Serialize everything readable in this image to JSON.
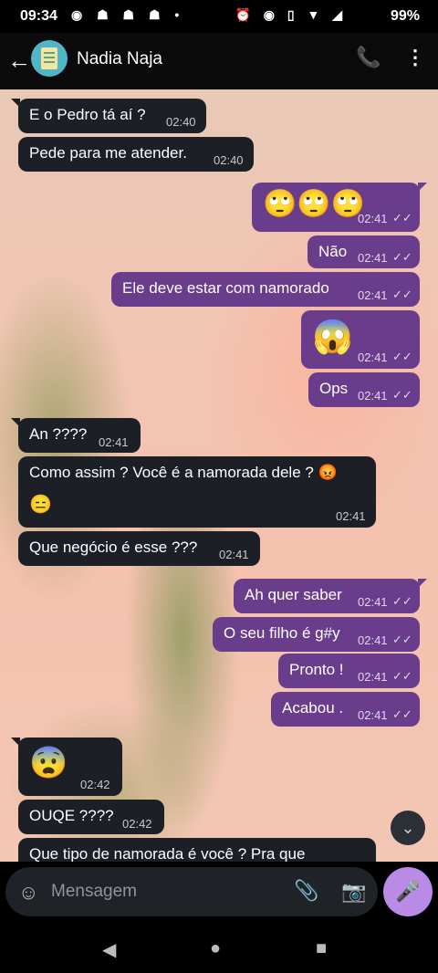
{
  "status": {
    "time": "09:34",
    "battery": "99%"
  },
  "header": {
    "contact_name": "Nadia Naja"
  },
  "messages": [
    {
      "dir": "in",
      "text": "E o Pedro tá aí ?",
      "time": "02:40"
    },
    {
      "dir": "in",
      "text": "Pede para me atender.",
      "time": "02:40"
    },
    {
      "dir": "out",
      "text": "🙄🙄🙄",
      "time": "02:41"
    },
    {
      "dir": "out",
      "text": "Não",
      "time": "02:41"
    },
    {
      "dir": "out",
      "text": "Ele deve estar com namorado",
      "time": "02:41"
    },
    {
      "dir": "out",
      "text": "😱",
      "time": "02:41"
    },
    {
      "dir": "out",
      "text": "Ops",
      "time": "02:41"
    },
    {
      "dir": "in",
      "text": "An ????",
      "time": "02:41"
    },
    {
      "dir": "in",
      "text": "Como assim ? Você é a namorada dele ? 😡",
      "text2": "😑",
      "time": "02:41"
    },
    {
      "dir": "in",
      "text": "Que negócio é esse ???",
      "time": "02:41"
    },
    {
      "dir": "out",
      "text": "Ah quer saber",
      "time": "02:41"
    },
    {
      "dir": "out",
      "text": "O seu filho é g#y",
      "time": "02:41"
    },
    {
      "dir": "out",
      "text": "Pronto !",
      "time": "02:41"
    },
    {
      "dir": "out",
      "text": "Acabou .",
      "time": "02:41"
    },
    {
      "dir": "in",
      "text": "😨",
      "time": "02:42"
    },
    {
      "dir": "in",
      "text": "OUQE ????",
      "time": "02:42"
    },
    {
      "dir": "in",
      "text": "Que tipo de namorada é você ? Pra que",
      "time": ""
    }
  ],
  "read_receipt": "✓✓",
  "composer": {
    "placeholder": "Mensagem"
  },
  "icons": {
    "back": "←",
    "call": "📞",
    "menu": "⋮",
    "scroll": "⌄",
    "sticker": "☺",
    "clip": "📎",
    "camera": "📷",
    "mic": "🎤",
    "nav_back": "◀",
    "nav_home": "●",
    "nav_recent": "■"
  }
}
